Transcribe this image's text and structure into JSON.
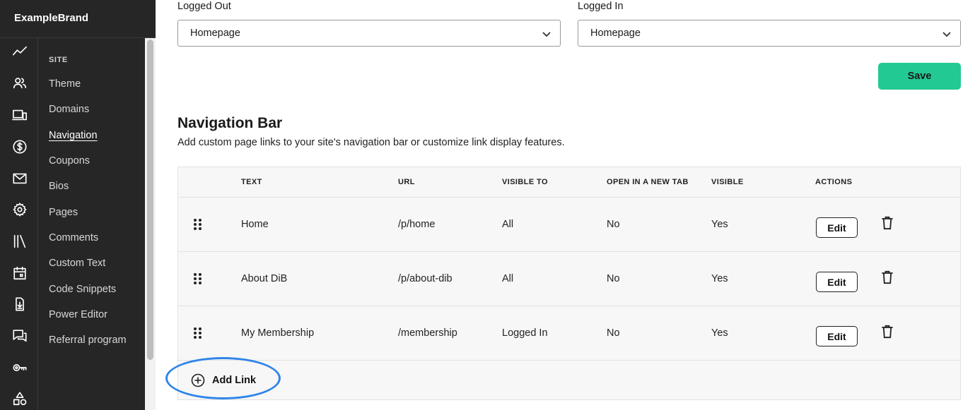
{
  "app": {
    "brand": "ExampleBrand"
  },
  "sidebar": {
    "rail_icons": [
      "analytics-icon",
      "members-icon",
      "site-devices-icon",
      "billing-dollar-icon",
      "mail-icon",
      "settings-gear-icon",
      "library-icon",
      "calendar-icon",
      "download-icon",
      "chat-icon",
      "key-icon",
      "shapes-icon"
    ],
    "section_label": "SITE",
    "items": [
      {
        "label": "Theme",
        "active": false
      },
      {
        "label": "Domains",
        "active": false
      },
      {
        "label": "Navigation",
        "active": true
      },
      {
        "label": "Coupons",
        "active": false
      },
      {
        "label": "Bios",
        "active": false
      },
      {
        "label": "Pages",
        "active": false
      },
      {
        "label": "Comments",
        "active": false
      },
      {
        "label": "Custom Text",
        "active": false
      },
      {
        "label": "Code Snippets",
        "active": false
      },
      {
        "label": "Power Editor",
        "active": false
      },
      {
        "label": "Referral program",
        "active": false
      }
    ]
  },
  "landing": {
    "logged_out": {
      "label": "Logged Out",
      "value": "Homepage"
    },
    "logged_in": {
      "label": "Logged In",
      "value": "Homepage"
    },
    "save_label": "Save"
  },
  "navigation_bar": {
    "title": "Navigation Bar",
    "description": "Add custom page links to your site's navigation bar or customize link display features.",
    "columns": [
      "TEXT",
      "URL",
      "VISIBLE TO",
      "OPEN IN A NEW TAB",
      "VISIBLE",
      "ACTIONS"
    ],
    "rows": [
      {
        "text": "Home",
        "url": "/p/home",
        "visible_to": "All",
        "new_tab": "No",
        "visible": "Yes",
        "edit_label": "Edit"
      },
      {
        "text": "About DiB",
        "url": "/p/about-dib",
        "visible_to": "All",
        "new_tab": "No",
        "visible": "Yes",
        "edit_label": "Edit"
      },
      {
        "text": "My Membership",
        "url": "/membership",
        "visible_to": "Logged In",
        "new_tab": "No",
        "visible": "Yes",
        "edit_label": "Edit"
      }
    ],
    "add_link_label": "Add Link"
  },
  "colors": {
    "sidebar_bg": "#262626",
    "accent_green": "#22c993",
    "highlight_blue": "#2f85e8"
  }
}
